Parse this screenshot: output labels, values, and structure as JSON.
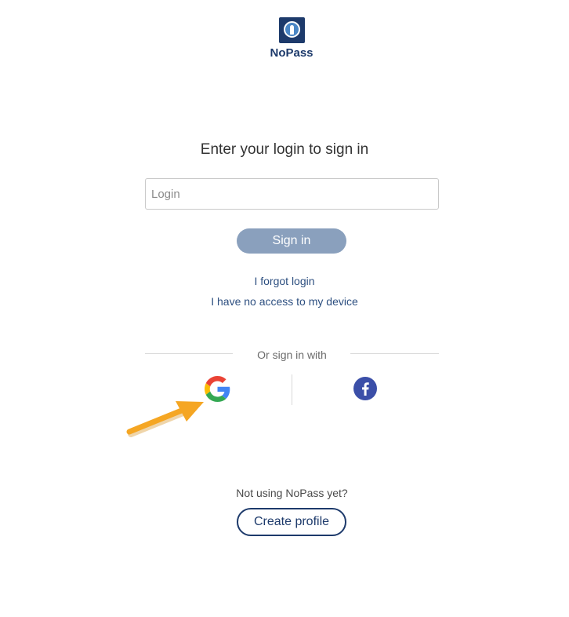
{
  "brand": {
    "name": "NoPass",
    "color": "#1d3a6b",
    "icon": "keyhole-icon"
  },
  "heading": "Enter your login to sign in",
  "login_input": {
    "placeholder": "Login",
    "value": ""
  },
  "signin_button": {
    "label": "Sign in",
    "color": "#8aa0bd"
  },
  "links": {
    "forgot_login": "I forgot login",
    "no_access": "I have no access to my device"
  },
  "social": {
    "divider_text": "Or sign in with",
    "providers": [
      "google-icon",
      "facebook-icon"
    ]
  },
  "signup": {
    "prompt": "Not using NoPass yet?",
    "button_label": "Create profile"
  },
  "annotation": {
    "icon": "arrow-icon",
    "color": "#f5a623"
  }
}
